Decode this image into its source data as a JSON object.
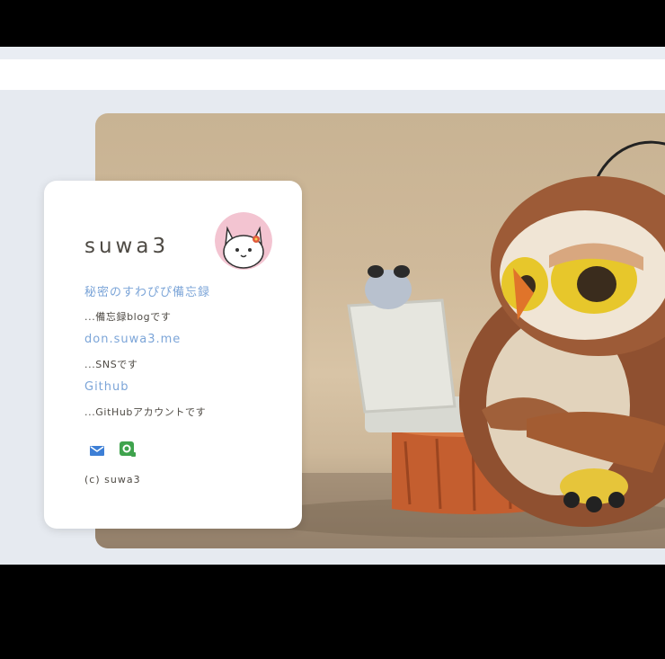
{
  "profile": {
    "title": "suwa3",
    "links": [
      {
        "label": "秘密のすわぴぴ備忘録",
        "description": "...備忘録blogです"
      },
      {
        "label": "don.suwa3.me",
        "description": "...SNSです"
      },
      {
        "label": "Github",
        "description": "...GitHubアカウントです"
      }
    ],
    "icons": [
      "mail-icon",
      "mastodon-icon"
    ],
    "copyright": "(c) suwa3"
  },
  "colors": {
    "link": "#7ca5d8",
    "text": "#4e4a44",
    "avatar_bg": "#f3c4d1",
    "mail_icon": "#3d7fd6",
    "sns_icon": "#3fa34d"
  }
}
